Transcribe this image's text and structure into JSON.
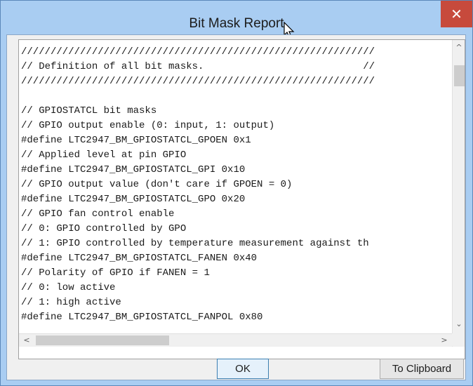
{
  "window": {
    "title": "Bit Mask Report",
    "close_glyph": "✕"
  },
  "editor": {
    "lines": [
      "////////////////////////////////////////////////////////////",
      "// Definition of all bit masks.                           //",
      "////////////////////////////////////////////////////////////",
      "",
      "// GPIOSTATCL bit masks",
      "// GPIO output enable (0: input, 1: output)",
      "#define LTC2947_BM_GPIOSTATCL_GPOEN 0x1",
      "// Applied level at pin GPIO",
      "#define LTC2947_BM_GPIOSTATCL_GPI 0x10",
      "// GPIO output value (don't care if GPOEN = 0)",
      "#define LTC2947_BM_GPIOSTATCL_GPO 0x20",
      "// GPIO fan control enable",
      "// 0: GPIO controlled by GPO",
      "// 1: GPIO controlled by temperature measurement against th",
      "#define LTC2947_BM_GPIOSTATCL_FANEN 0x40",
      "// Polarity of GPIO if FANEN = 1",
      "// 0: low active",
      "// 1: high active",
      "#define LTC2947_BM_GPIOSTATCL_FANPOL 0x80"
    ],
    "scroll_up_glyph": "^",
    "scroll_down_glyph": "⌄",
    "scroll_left_glyph": "<",
    "scroll_right_glyph": ">"
  },
  "buttons": {
    "ok": "OK",
    "clipboard": "To Clipboard"
  }
}
